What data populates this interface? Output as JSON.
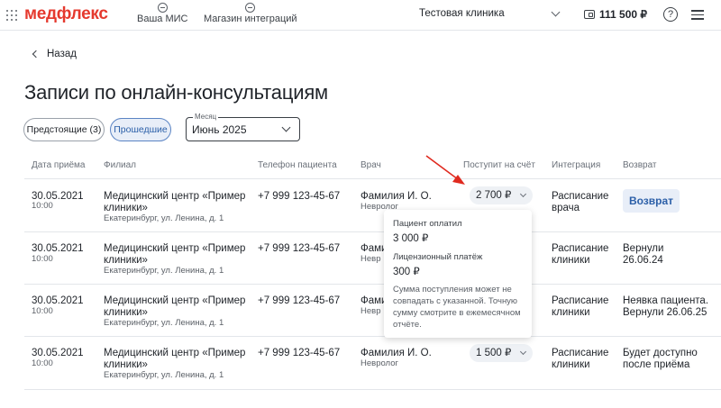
{
  "header": {
    "logo": "медфлекс",
    "nav": [
      {
        "label": "Ваша МИС"
      },
      {
        "label": "Магазин интеграций"
      }
    ],
    "clinic": "Тестовая клиника",
    "balance": "111 500 ₽",
    "help": "?"
  },
  "back_label": "Назад",
  "page_title": "Записи по онлайн-консультациям",
  "filters": {
    "upcoming": "Предстоящие (3)",
    "past": "Прошедшие",
    "month_label": "Месяц",
    "month_value": "Июнь 2025"
  },
  "table": {
    "columns": [
      "Дата приёма",
      "Филиал",
      "Телефон пациента",
      "Врач",
      "Поступит на счёт",
      "Интеграция",
      "Возврат"
    ],
    "rows": [
      {
        "date": "30.05.2021",
        "time": "10:00",
        "branch": [
          "Медицинский центр «Пример",
          "клиники»"
        ],
        "address": "Екатеринбург, ул. Ленина, д. 1",
        "phone": "+7 999 123-45-67",
        "doctor": "Фамилия И. О.",
        "specialty": "Невролог",
        "amount": "2 700 ₽",
        "integration": [
          "Расписание",
          "врача"
        ],
        "refund_button": "Возврат"
      },
      {
        "date": "30.05.2021",
        "time": "10:00",
        "branch": [
          "Медицинский центр «Пример",
          "клиники»"
        ],
        "address": "Екатеринбург, ул. Ленина, д. 1",
        "phone": "+7 999 123-45-67",
        "doctor": "Фами",
        "specialty": "Невр",
        "integration": [
          "Расписание",
          "клиники"
        ],
        "refund": [
          "Вернули",
          "26.06.24"
        ]
      },
      {
        "date": "30.05.2021",
        "time": "10:00",
        "branch": [
          "Медицинский центр «Пример",
          "клиники»"
        ],
        "address": "Екатеринбург, ул. Ленина, д. 1",
        "phone": "+7 999 123-45-67",
        "doctor": "Фами",
        "specialty": "Невр",
        "integration": [
          "Расписание",
          "клиники"
        ],
        "refund": [
          "Неявка пациента.",
          "Вернули 26.06.25"
        ]
      },
      {
        "date": "30.05.2021",
        "time": "10:00",
        "branch": [
          "Медицинский центр «Пример",
          "клиники»"
        ],
        "address": "Екатеринбург, ул. Ленина, д. 1",
        "phone": "+7 999 123-45-67",
        "doctor": "Фамилия И. О.",
        "specialty": "Невролог",
        "amount": "1 500 ₽",
        "integration": [
          "Расписание",
          "клиники"
        ],
        "refund": [
          "Будет доступно",
          "после приёма"
        ]
      }
    ]
  },
  "popover": {
    "paid_label": "Пациент оплатил",
    "paid_value": "3 000 ₽",
    "license_label": "Лицензионный платёж",
    "license_value": "300 ₽",
    "note": "Сумма поступления может не совпадать с указанной. Точную сумму смотрите в ежемесячном отчёте."
  },
  "colors": {
    "brand": "#e5392e",
    "accent": "#2b5fa8",
    "annotation_arrow": "#e02a1f"
  }
}
